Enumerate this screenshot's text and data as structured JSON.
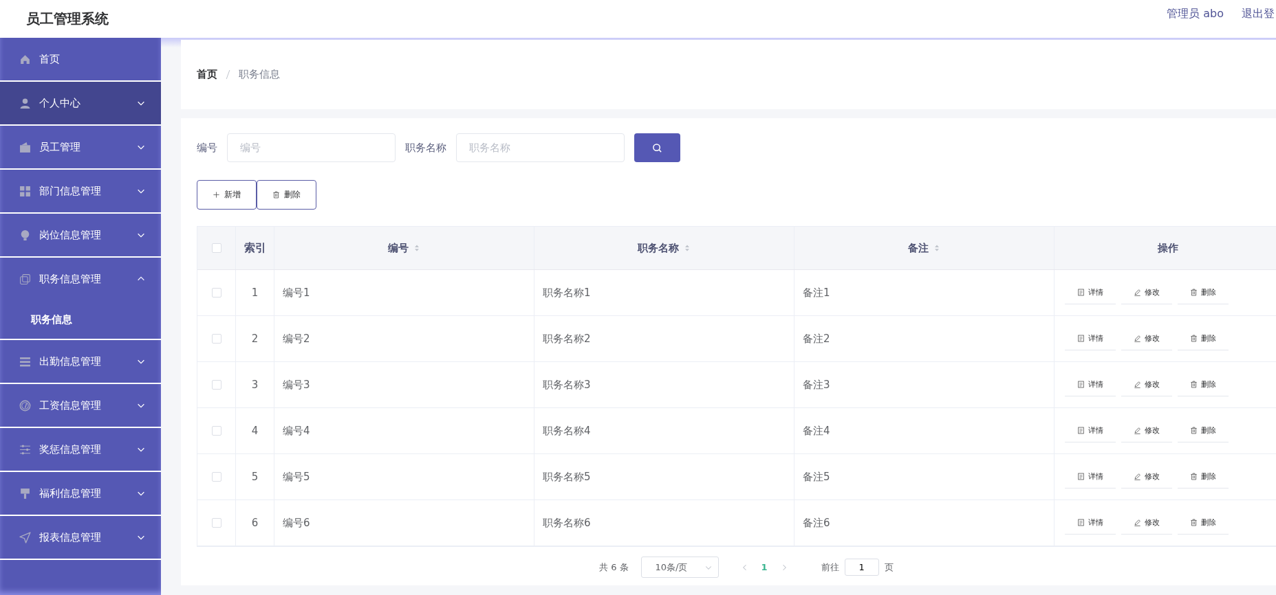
{
  "header": {
    "title": "员工管理系统",
    "user": "管理员 abo",
    "logout": "退出登"
  },
  "sidebar": {
    "items": [
      {
        "label": "首页",
        "hovered": false
      },
      {
        "label": "个人中心",
        "hovered": true,
        "expanded": false
      },
      {
        "label": "员工管理",
        "hovered": false,
        "expanded": false
      },
      {
        "label": "部门信息管理",
        "hovered": false,
        "expanded": false
      },
      {
        "label": "岗位信息管理",
        "hovered": false,
        "expanded": false
      },
      {
        "label": "职务信息管理",
        "hovered": false,
        "expanded": true,
        "children": [
          {
            "label": "职务信息",
            "selected": true
          }
        ]
      },
      {
        "label": "出勤信息管理",
        "hovered": false,
        "expanded": false
      },
      {
        "label": "工资信息管理",
        "hovered": false,
        "expanded": false
      },
      {
        "label": "奖惩信息管理",
        "hovered": false,
        "expanded": false
      },
      {
        "label": "福利信息管理",
        "hovered": false,
        "expanded": false
      },
      {
        "label": "报表信息管理",
        "hovered": false,
        "expanded": false
      }
    ]
  },
  "breadcrumb": [
    "首页",
    "职务信息"
  ],
  "search": {
    "fields": [
      {
        "label": "编号",
        "placeholder": "编号"
      },
      {
        "label": "职务名称",
        "placeholder": "职务名称"
      }
    ]
  },
  "toolbar": [
    "新增",
    "删除"
  ],
  "table": {
    "select_all": false,
    "index_column": "索引",
    "columns": [
      {
        "label": "编号",
        "sortable": true
      },
      {
        "label": "职务名称",
        "sortable": true
      },
      {
        "label": "备注",
        "sortable": true
      },
      {
        "label": "操作"
      }
    ],
    "rows": [
      {
        "checked": false,
        "index": "1",
        "cells": [
          "编号1",
          "职务名称1",
          "备注1"
        ],
        "actions": [
          "详情",
          "修改",
          "删除"
        ]
      },
      {
        "checked": false,
        "index": "2",
        "cells": [
          "编号2",
          "职务名称2",
          "备注2"
        ],
        "actions": [
          "详情",
          "修改",
          "删除"
        ]
      },
      {
        "checked": false,
        "index": "3",
        "cells": [
          "编号3",
          "职务名称3",
          "备注3"
        ],
        "actions": [
          "详情",
          "修改",
          "删除"
        ]
      },
      {
        "checked": false,
        "index": "4",
        "cells": [
          "编号4",
          "职务名称4",
          "备注4"
        ],
        "actions": [
          "详情",
          "修改",
          "删除"
        ]
      },
      {
        "checked": false,
        "index": "5",
        "cells": [
          "编号5",
          "职务名称5",
          "备注5"
        ],
        "actions": [
          "详情",
          "修改",
          "删除"
        ]
      },
      {
        "checked": false,
        "index": "6",
        "cells": [
          "编号6",
          "职务名称6",
          "备注6"
        ],
        "actions": [
          "详情",
          "修改",
          "删除"
        ]
      }
    ]
  },
  "pagination": {
    "total": "共 6 条",
    "page_size": "10条/页",
    "pages": [
      {
        "label": "1",
        "selected": true
      }
    ],
    "goto_label": "前往",
    "goto_value": "1",
    "goto_suffix": "页"
  }
}
